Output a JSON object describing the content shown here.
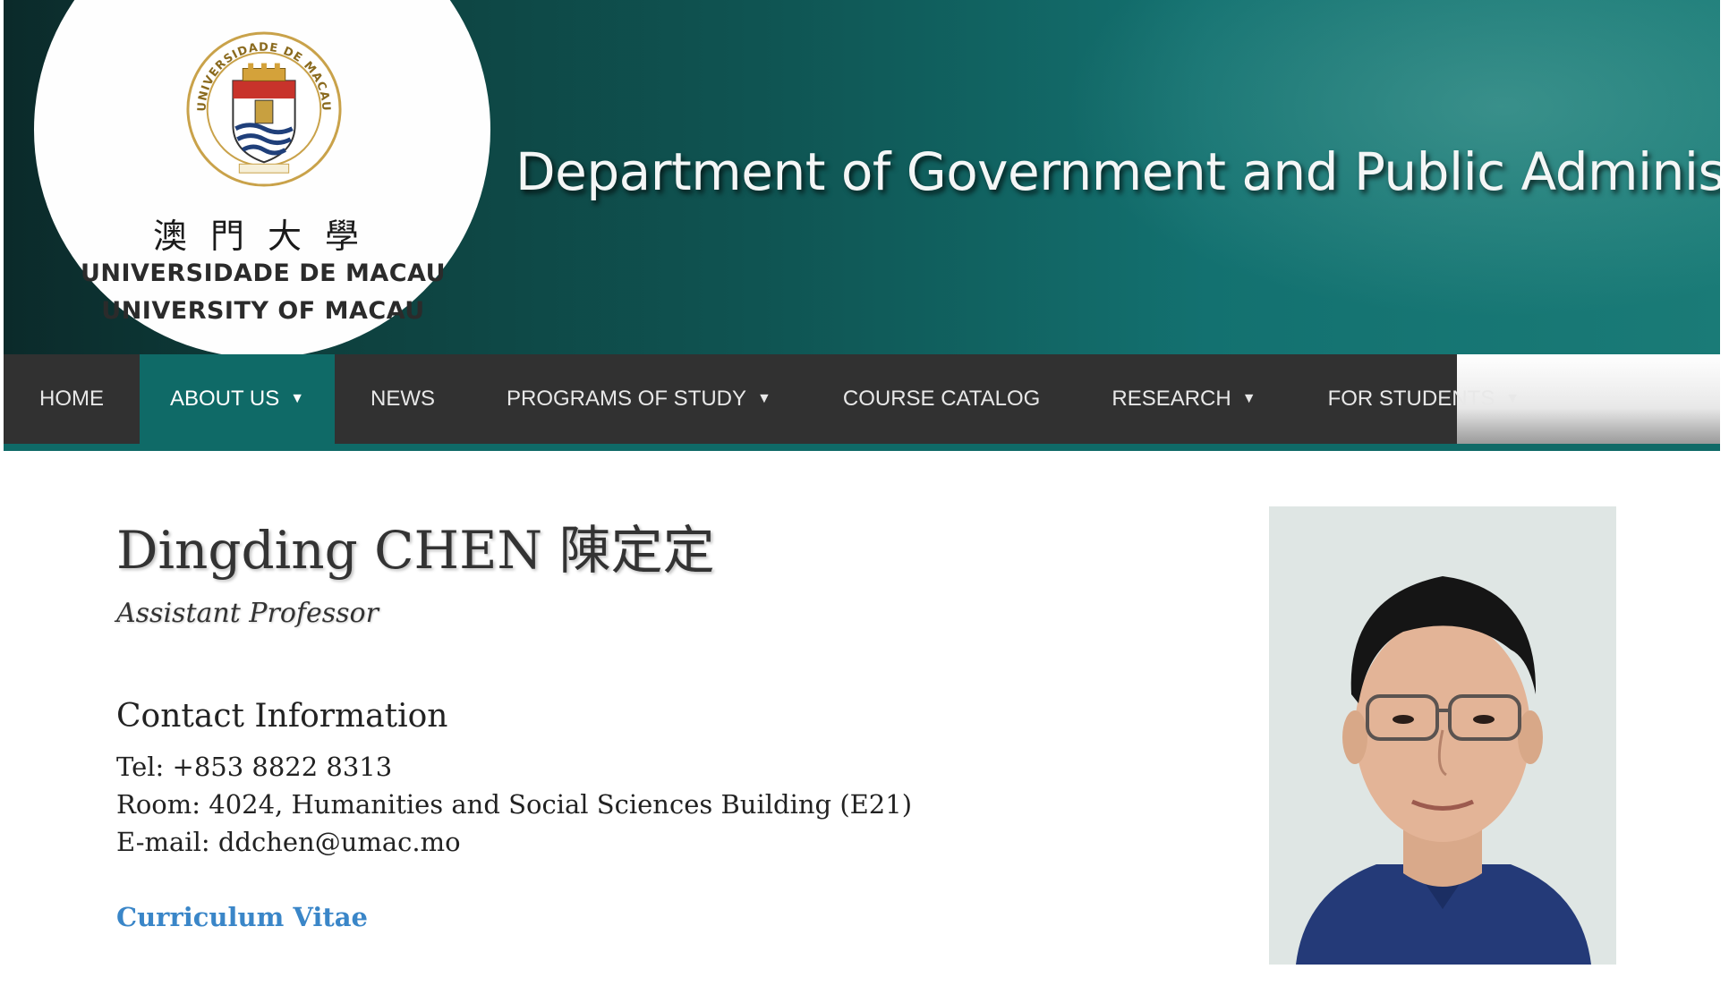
{
  "header": {
    "department_title": "Department of Government and Public Administration",
    "university_chinese": "澳門大學",
    "university_pt": "UNIVERSIDADE DE MACAU",
    "university_en": "UNIVERSITY OF MACAU",
    "seal_text": "UNIVERSIDADE DE MACAU",
    "colors": {
      "accent": "#0f6a67",
      "nav_bg": "#313131"
    }
  },
  "nav": {
    "items": [
      {
        "label": "HOME",
        "dropdown": false
      },
      {
        "label": "ABOUT US",
        "dropdown": true,
        "active": true
      },
      {
        "label": "NEWS",
        "dropdown": false
      },
      {
        "label": "PROGRAMS OF STUDY",
        "dropdown": true
      },
      {
        "label": "COURSE CATALOG",
        "dropdown": false
      },
      {
        "label": "RESEARCH",
        "dropdown": true
      },
      {
        "label": "FOR STUDENTS",
        "dropdown": true
      }
    ],
    "caret_glyph": "▼"
  },
  "profile": {
    "name": "Dingding CHEN 陳定定",
    "title": "Assistant Professor",
    "contact_heading": "Contact Information",
    "tel": "Tel: +853 8822 8313",
    "room": "Room: 4024, Humanities and Social Sciences Building (E21)",
    "email": "E-mail: ddchen@umac.mo",
    "cv_link": "Curriculum Vitae",
    "link_color": "#3a86c8"
  }
}
